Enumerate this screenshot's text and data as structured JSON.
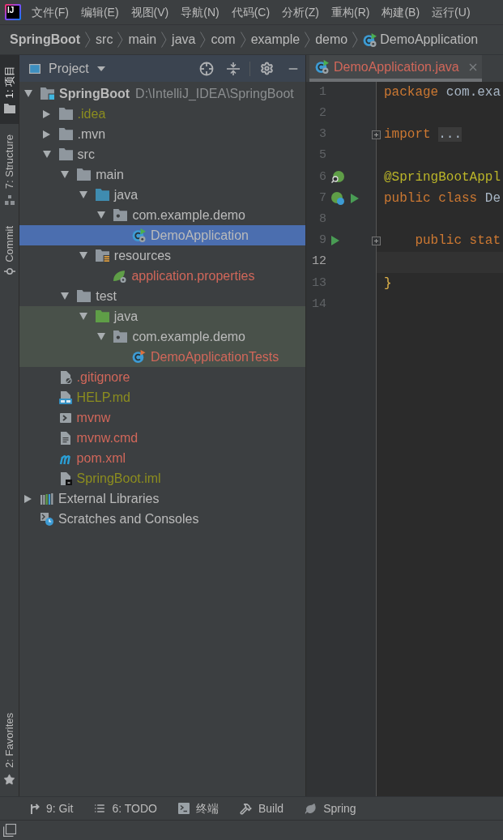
{
  "menu_bar": {
    "logo": "IJ",
    "items": [
      "文件(F)",
      "编辑(E)",
      "视图(V)",
      "导航(N)",
      "代码(C)",
      "分析(Z)",
      "重构(R)",
      "构建(B)",
      "运行(U)"
    ]
  },
  "breadcrumbs": [
    {
      "label": "SpringBoot",
      "kind": "project"
    },
    {
      "label": "src",
      "kind": "folder"
    },
    {
      "label": "main",
      "kind": "folder"
    },
    {
      "label": "java",
      "kind": "folder"
    },
    {
      "label": "com",
      "kind": "folder"
    },
    {
      "label": "example",
      "kind": "folder"
    },
    {
      "label": "demo",
      "kind": "folder"
    },
    {
      "label": "DemoApplication",
      "kind": "class"
    }
  ],
  "tool_strip": {
    "top": [
      {
        "label": "1: 项目",
        "kind": "project",
        "selected": true
      },
      {
        "label": "7: Structure",
        "kind": "structure",
        "selected": false
      },
      {
        "label": "Commit",
        "kind": "commit",
        "selected": false
      }
    ],
    "bottom": [
      {
        "label": "2: Favorites",
        "kind": "favorites",
        "selected": false
      }
    ]
  },
  "project_panel": {
    "title": "Project",
    "tree": [
      {
        "label": "SpringBoot",
        "path": "D:\\IntelliJ_IDEA\\SpringBoot",
        "kind": "module",
        "color": "#bbbbbb",
        "expanded": true,
        "selected": false,
        "tinted": false,
        "children": [
          {
            "label": ".idea",
            "kind": "folder",
            "color": "#8c8d1f",
            "expanded": false,
            "selected": false,
            "tinted": false
          },
          {
            "label": ".mvn",
            "kind": "folder",
            "color": "#bbbbbb",
            "expanded": false,
            "selected": false,
            "tinted": false
          },
          {
            "label": "src",
            "kind": "folder",
            "color": "#bbbbbb",
            "expanded": true,
            "selected": false,
            "tinted": false,
            "children": [
              {
                "label": "main",
                "kind": "folder",
                "color": "#bbbbbb",
                "expanded": true,
                "selected": false,
                "tinted": false,
                "children": [
                  {
                    "label": "java",
                    "kind": "source-root",
                    "color": "#bbbbbb",
                    "expanded": true,
                    "selected": false,
                    "tinted": false,
                    "children": [
                      {
                        "label": "com.example.demo",
                        "kind": "package",
                        "color": "#bbbbbb",
                        "expanded": true,
                        "selected": false,
                        "tinted": false,
                        "children": [
                          {
                            "label": "DemoApplication",
                            "kind": "class",
                            "selected": true
                          }
                        ]
                      }
                    ]
                  },
                  {
                    "label": "resources",
                    "kind": "resource-root",
                    "color": "#bbbbbb",
                    "expanded": true,
                    "selected": false,
                    "tinted": false,
                    "children": [
                      {
                        "label": "application.properties",
                        "kind": "properties",
                        "color": "#d1675a",
                        "selected": false,
                        "tinted": false
                      }
                    ]
                  }
                ]
              },
              {
                "label": "test",
                "kind": "folder",
                "color": "#bbbbbb",
                "expanded": true,
                "selected": false,
                "tinted": false,
                "children": [
                  {
                    "label": "java",
                    "kind": "test-root",
                    "color": "#bbbbbb",
                    "expanded": true,
                    "selected": false,
                    "tinted": true,
                    "children": [
                      {
                        "label": "com.example.demo",
                        "kind": "package",
                        "color": "#bbbbbb",
                        "expanded": true,
                        "selected": false,
                        "tinted": true,
                        "children": [
                          {
                            "label": "DemoApplicationTests",
                            "kind": "test-class",
                            "color": "#d1675a",
                            "selected": false,
                            "tinted": true
                          }
                        ]
                      }
                    ]
                  }
                ]
              }
            ]
          },
          {
            "label": ".gitignore",
            "kind": "gitignore",
            "color": "#d1675a",
            "selected": false,
            "tinted": false
          },
          {
            "label": "HELP.md",
            "kind": "markdown",
            "color": "#8c8d1f",
            "selected": false,
            "tinted": false
          },
          {
            "label": "mvnw",
            "kind": "shell",
            "color": "#d1675a",
            "selected": false,
            "tinted": false
          },
          {
            "label": "mvnw.cmd",
            "kind": "text",
            "color": "#d1675a",
            "selected": false,
            "tinted": false
          },
          {
            "label": "pom.xml",
            "kind": "maven",
            "color": "#d1675a",
            "selected": false,
            "tinted": false
          },
          {
            "label": "SpringBoot.iml",
            "kind": "module-file",
            "color": "#8c8d1f",
            "selected": false,
            "tinted": false
          }
        ]
      },
      {
        "label": "External Libraries",
        "kind": "libraries",
        "color": "#bbbbbb",
        "expanded": false,
        "selected": false,
        "tinted": false
      },
      {
        "label": "Scratches and Consoles",
        "kind": "scratches",
        "color": "#bbbbbb",
        "selected": false,
        "tinted": false
      }
    ]
  },
  "editor": {
    "tabs": [
      {
        "label": "DemoApplication.java",
        "kind": "class",
        "color": "#d1675a",
        "selected": true
      }
    ],
    "lines": [
      {
        "number": "1",
        "current": false,
        "fold": false,
        "tokens": [
          {
            "text": "package",
            "kind": "keyword"
          },
          {
            "text": " com.exa",
            "kind": "plain"
          }
        ]
      },
      {
        "number": "2",
        "current": false,
        "fold": false
      },
      {
        "number": "3",
        "current": false,
        "fold": true,
        "tokens": [
          {
            "text": "import",
            "kind": "keyword"
          },
          {
            "text": "...",
            "kind": "folded"
          }
        ]
      },
      {
        "number": "5",
        "current": false,
        "fold": false
      },
      {
        "number": "6",
        "current": false,
        "fold": false,
        "markers": [
          {
            "kind": "bean-search"
          }
        ],
        "tokens": [
          {
            "text": "@SpringBootAppl",
            "kind": "annotation"
          }
        ]
      },
      {
        "number": "7",
        "current": false,
        "fold": false,
        "markers": [
          {
            "kind": "bean-link"
          },
          {
            "kind": "run"
          }
        ],
        "tokens": [
          {
            "text": "public class",
            "kind": "keyword"
          },
          {
            "text": " De",
            "kind": "plain"
          }
        ]
      },
      {
        "number": "8",
        "current": false,
        "fold": false
      },
      {
        "number": "9",
        "current": false,
        "fold": true,
        "markers": [
          {
            "kind": "run"
          }
        ],
        "tokens": [
          {
            "text": "    public stat",
            "kind": "keyword"
          }
        ]
      },
      {
        "number": "12",
        "current": true,
        "fold": false
      },
      {
        "number": "13",
        "current": false,
        "fold": false,
        "tokens": [
          {
            "text": "}",
            "kind": "brace"
          }
        ]
      },
      {
        "number": "14",
        "current": false,
        "fold": false
      }
    ]
  },
  "bottom_bar": [
    {
      "label": "9: Git",
      "kind": "git"
    },
    {
      "label": "6: TODO",
      "kind": "todo"
    },
    {
      "label": "终端",
      "kind": "terminal"
    },
    {
      "label": "Build",
      "kind": "build"
    },
    {
      "label": "Spring",
      "kind": "spring"
    }
  ]
}
